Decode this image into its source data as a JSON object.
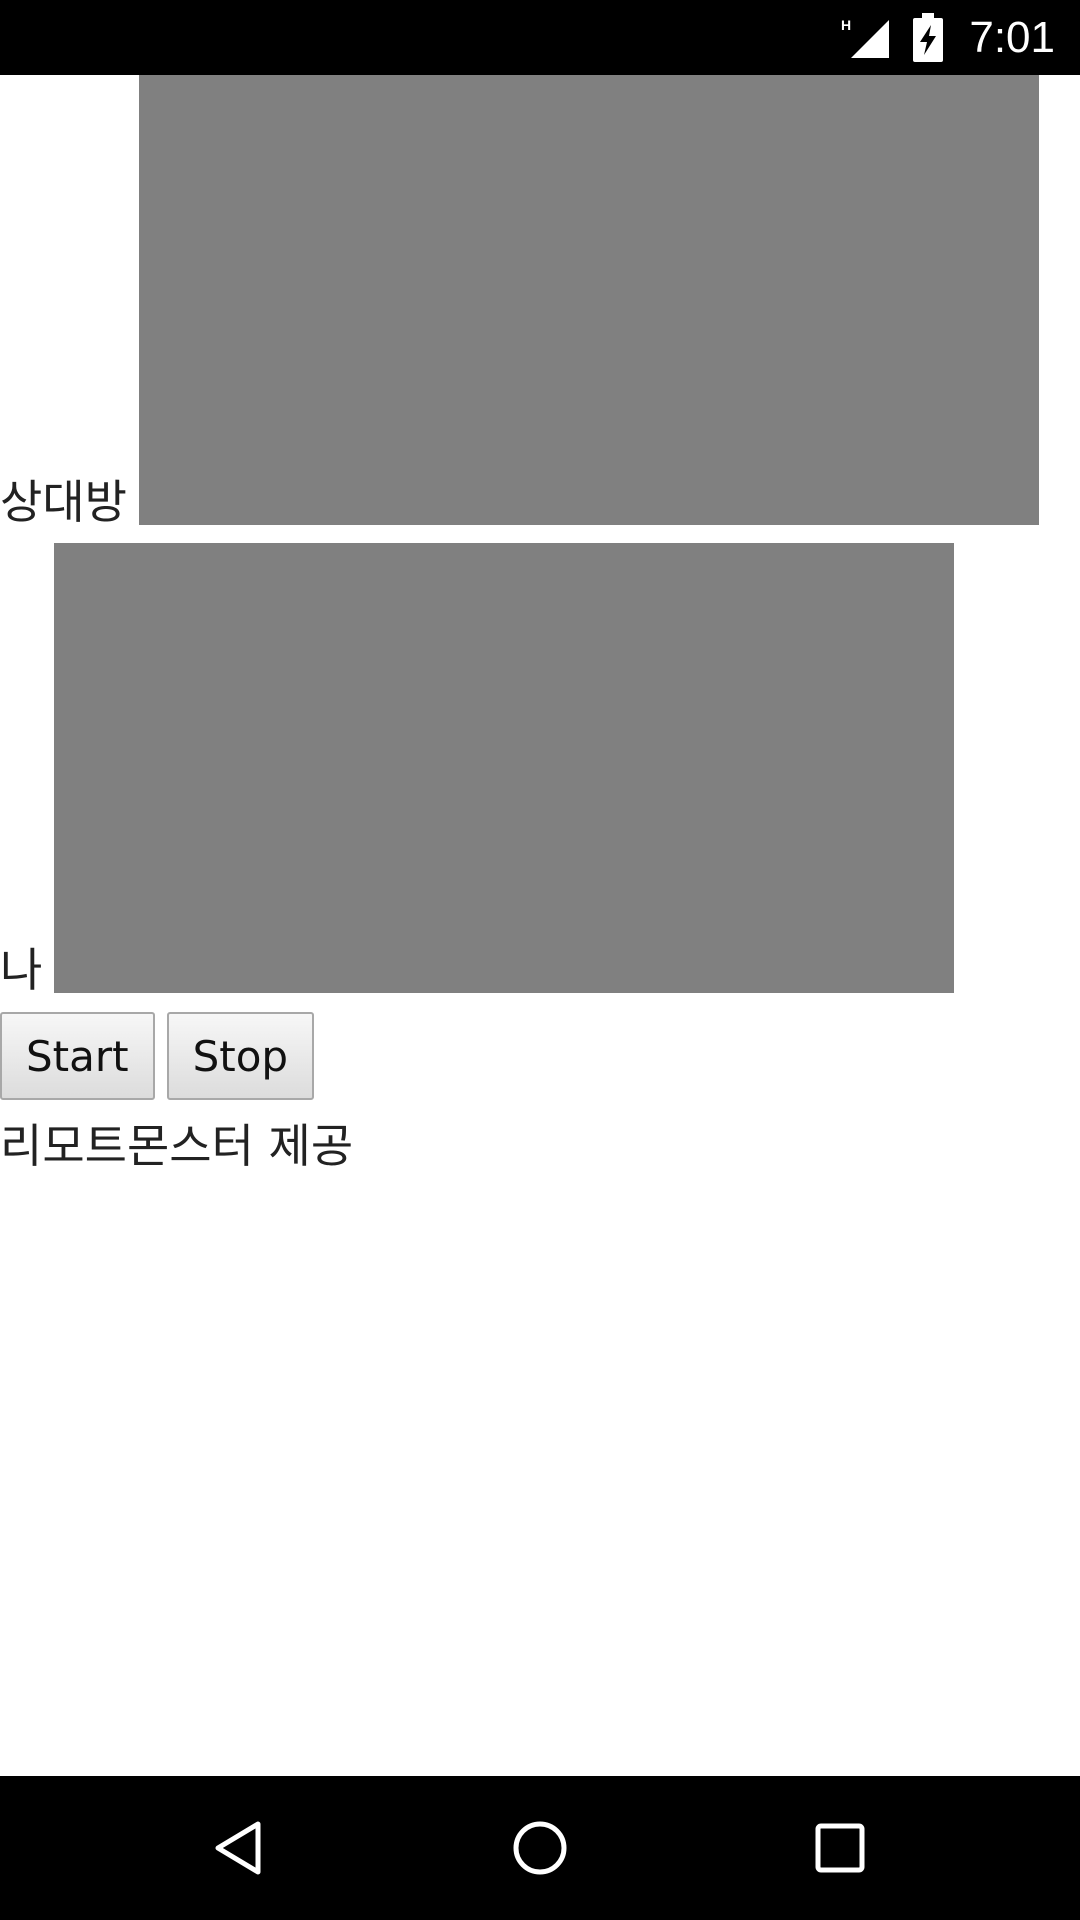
{
  "status_bar": {
    "network_indicator": "H",
    "time": "7:01",
    "icons": [
      "signal-icon",
      "battery-charging-icon"
    ]
  },
  "remote_video": {
    "label": "상대방"
  },
  "local_video": {
    "label": "나"
  },
  "controls": {
    "start_label": "Start",
    "stop_label": "Stop"
  },
  "footer": {
    "credit": "리모트몬스터 제공"
  },
  "nav_bar": {
    "icons": [
      "back-icon",
      "home-icon",
      "recents-icon"
    ]
  },
  "colors": {
    "video_placeholder": "#808080",
    "system_bars": "#000000"
  }
}
